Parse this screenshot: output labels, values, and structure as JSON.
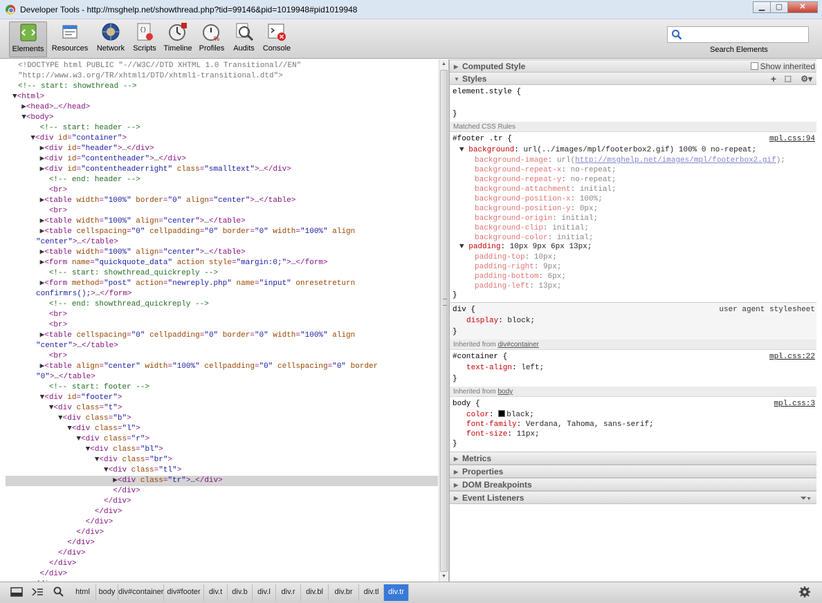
{
  "window": {
    "title": "Developer Tools - http://msghelp.net/showthread.php?tid=99146&pid=1019948#pid1019948"
  },
  "toolbar": {
    "tools": [
      {
        "label": "Elements",
        "icon": "elements-icon"
      },
      {
        "label": "Resources",
        "icon": "resources-icon"
      },
      {
        "label": "Network",
        "icon": "network-icon"
      },
      {
        "label": "Scripts",
        "icon": "scripts-icon"
      },
      {
        "label": "Timeline",
        "icon": "timeline-icon"
      },
      {
        "label": "Profiles",
        "icon": "profiles-icon"
      },
      {
        "label": "Audits",
        "icon": "audits-icon"
      },
      {
        "label": "Console",
        "icon": "console-icon"
      }
    ],
    "search_label": "Search Elements",
    "search_value": ""
  },
  "dom": [
    "<!DOCTYPE html PUBLIC \"-//W3C//DTD XHTML 1.0 Transitional//EN\"",
    "\"http://www.w3.org/TR/xhtml1/DTD/xhtml1-transitional.dtd\">",
    "<!-- start: showthread -->",
    "▼<html>",
    "  ▶<head>…</head>",
    "  ▼<body>",
    "      <!-- start: header -->",
    "    ▼<div id=\"container\">",
    "      ▶<div id=\"header\">…</div>",
    "      ▶<div id=\"contentheader\">…</div>",
    "      ▶<div id=\"contentheaderright\" class=\"smalltext\">…</div>",
    "        <!-- end: header -->",
    "        <br>",
    "      ▶<table width=\"100%\" border=\"0\" align=\"center\">…</table>",
    "        <br>",
    "      ▶<table width=\"100%\" align=\"center\">…</table>",
    "      ▶<table cellspacing=\"0\" cellpadding=\"0\" border=\"0\" width=\"100%\" align=",
    "\"center\">…</table>",
    "      ▶<table width=\"100%\" align=\"center\">…</table>",
    "      ▶<form name=\"quickquote_data\" action style=\"margin:0;\">…</form>",
    "        <!-- start: showthread_quickreply -->",
    "      ▶<form method=\"post\" action=\"newreply.php\" name=\"input\" onreset=\"return",
    "confirmrs();\">…</form>",
    "        <!-- end: showthread_quickreply -->",
    "        <br>",
    "        <br>",
    "      ▶<table cellspacing=\"0\" cellpadding=\"0\" border=\"0\" width=\"100%\" align=",
    "\"center\">…</table>",
    "        <br>",
    "      ▶<table align=\"center\" width=\"100%\" cellpadding=\"0\" cellspacing=\"0\" border=",
    "\"0\">…</table>",
    "        <!-- start: footer -->",
    "      ▼<div id=\"footer\">",
    "        ▼<div class=\"t\">",
    "          ▼<div class=\"b\">",
    "            ▼<div class=\"l\">",
    "              ▼<div class=\"r\">",
    "                ▼<div class=\"bl\">",
    "                  ▼<div class=\"br\">",
    "                    ▼<div class=\"tl\">",
    "                      ▶<div class=\"tr\">…</div>",
    "                      </div>",
    "                    </div>",
    "                  </div>",
    "                </div>",
    "              </div>",
    "            </div>",
    "          </div>",
    "        </div>",
    "      </div>",
    "    </div>",
    "      <!-- end: id=container -->"
  ],
  "dom_selected_index": 40,
  "side": {
    "computed": "Computed Style",
    "show_inherited": "Show inherited",
    "styles": "Styles",
    "element_style": "element.style {",
    "close_brace": "}",
    "matched": "Matched CSS Rules",
    "footer_rule": {
      "selector": "#footer .tr {",
      "source": "mpl.css:94"
    },
    "background": {
      "name": "background",
      "value": "url(../images/mpl/footerbox2.gif) 100% 0 no-repeat;"
    },
    "bg_long": [
      {
        "name": "background-image",
        "value": "url(",
        "link": "http://msghelp.net/images/mpl/footerbox2.gif",
        "after": ");"
      },
      {
        "name": "background-repeat-x",
        "value": "no-repeat;"
      },
      {
        "name": "background-repeat-y",
        "value": "no-repeat;"
      },
      {
        "name": "background-attachment",
        "value": "initial;"
      },
      {
        "name": "background-position-x",
        "value": "100%;"
      },
      {
        "name": "background-position-y",
        "value": "0px;"
      },
      {
        "name": "background-origin",
        "value": "initial;"
      },
      {
        "name": "background-clip",
        "value": "initial;"
      },
      {
        "name": "background-color",
        "value": "initial;"
      }
    ],
    "padding": {
      "name": "padding",
      "value": "10px 9px 6px 13px;"
    },
    "pad_long": [
      {
        "name": "padding-top",
        "value": "10px;"
      },
      {
        "name": "padding-right",
        "value": "9px;"
      },
      {
        "name": "padding-bottom",
        "value": "6px;"
      },
      {
        "name": "padding-left",
        "value": "13px;"
      }
    ],
    "div_rule": {
      "selector": "div {",
      "source": "user agent stylesheet",
      "prop": "display",
      "value": "block;"
    },
    "inh_container": {
      "prefix": "Inherited from ",
      "link": "div#container"
    },
    "container_rule": {
      "selector": "#container {",
      "source": "mpl.css:22",
      "prop": "text-align",
      "value": "left;"
    },
    "inh_body": {
      "prefix": "Inherited from ",
      "link": "body"
    },
    "body_rule": {
      "selector": "body {",
      "source": "mpl.css:3",
      "props": [
        {
          "name": "color",
          "value": "black;"
        },
        {
          "name": "font-family",
          "value": "Verdana, Tahoma, sans-serif;"
        },
        {
          "name": "font-size",
          "value": "11px;"
        }
      ]
    },
    "metrics": "Metrics",
    "properties": "Properties",
    "dom_breakpoints": "DOM Breakpoints",
    "event_listeners": "Event Listeners"
  },
  "breadcrumbs": [
    "html",
    "body",
    "div#container",
    "div#footer",
    "div.t",
    "div.b",
    "div.l",
    "div.r",
    "div.bl",
    "div.br",
    "div.tl",
    "div.tr"
  ]
}
